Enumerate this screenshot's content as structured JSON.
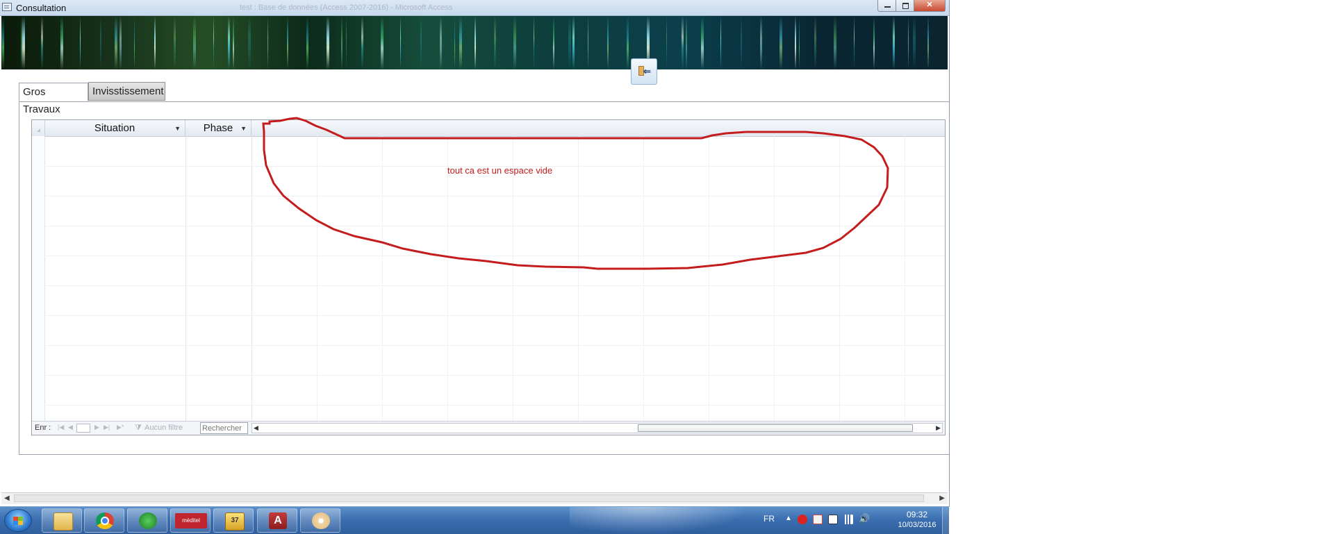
{
  "window": {
    "title": "Consultation",
    "subtitle": "test : Base de données (Access 2007-2016) - Microsoft Access"
  },
  "header": {
    "exit_icon": "exit-door-icon"
  },
  "tabs": [
    {
      "label": "Gros Travaux",
      "active": true
    },
    {
      "label": "Invisstissement",
      "active": false
    }
  ],
  "datasheet": {
    "columns": [
      {
        "label": "Situation"
      },
      {
        "label": "Phase"
      }
    ],
    "rows": []
  },
  "navbar": {
    "record_label": "Enr :",
    "record_value": "",
    "filter_label": "Aucun filtre",
    "search_placeholder": "Rechercher"
  },
  "annotation": {
    "text": "tout ca est un espace vide",
    "color": "#c41c1c"
  },
  "taskbar": {
    "apps": [
      {
        "name": "windows-explorer"
      },
      {
        "name": "google-chrome"
      },
      {
        "name": "internet-download-manager"
      },
      {
        "name": "mediatel",
        "label": "méditel"
      },
      {
        "name": "calendar",
        "label": "37"
      },
      {
        "name": "microsoft-access",
        "label": "A"
      },
      {
        "name": "paint"
      }
    ],
    "language": "FR",
    "time": "09:32",
    "date": "10/03/2016"
  }
}
